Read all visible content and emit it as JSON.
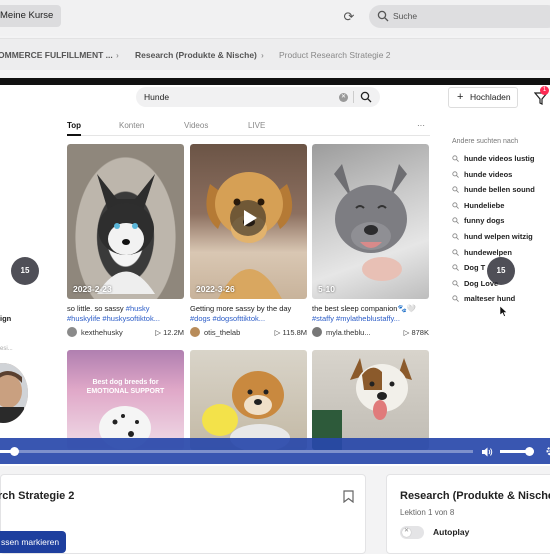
{
  "topbar": {
    "tab_label": "Meine Kurse",
    "search_placeholder": "Suche"
  },
  "breadcrumb": [
    "OMMERCE FULFILLMENT ...",
    "Research (Produkte & Nische)",
    "Product Research Strategie 2"
  ],
  "tiktok": {
    "search_value": "Hunde",
    "upload_label": "Hochladen",
    "notification_count": "1",
    "tabs": [
      "Top",
      "Konten",
      "Videos",
      "LIVE"
    ],
    "active_tab": "Top",
    "more": "···",
    "videos": [
      {
        "date": "2023-2-23",
        "caption_text": "so little. so sassy ",
        "caption_tags": "#husky #huskylife #huskysoftiktok...",
        "user": "kexthehusky",
        "views": "12.2M"
      },
      {
        "date": "2022-3-26",
        "caption_text": "Getting more sassy by the day ",
        "caption_tags": "#dogs #dogsofttiktok...",
        "user": "otis_thelab",
        "views": "115.8M"
      },
      {
        "date": "5-10",
        "caption_text": "the best sleep companion🐾🤍 ",
        "caption_tags": "#staffy #mylatheblustaffy...",
        "user": "myla.theblu...",
        "views": "878K"
      }
    ],
    "second_row_overlay": "Best dog breeds for EMOTIONAL SUPPORT",
    "sidebar_title": "Andere suchten nach",
    "suggestions": [
      "hunde videos lustig",
      "hunde videos",
      "hunde bellen sound",
      "Hundeliebe",
      "funny dogs",
      "hund welpen witzig",
      "hundewelpen",
      "Dog T",
      "Dog Love",
      "malteser hund"
    ],
    "left_label": "ign",
    "left_sub": "esi..."
  },
  "player": {
    "skip_label": "15",
    "progress": 0.03,
    "volume": 0.85
  },
  "bottom": {
    "left_title": "rch Strategie 2",
    "mark_button": "ssen markieren",
    "right_title": "Research (Produkte & Nische)",
    "lesson": "Lektion 1 von 8",
    "autoplay": "Autoplay"
  },
  "colors": {
    "accent": "#1e3f9e",
    "controls": "#2848aa",
    "tiktok_red": "#fe2c55",
    "tag_blue": "#2b5cc7"
  }
}
